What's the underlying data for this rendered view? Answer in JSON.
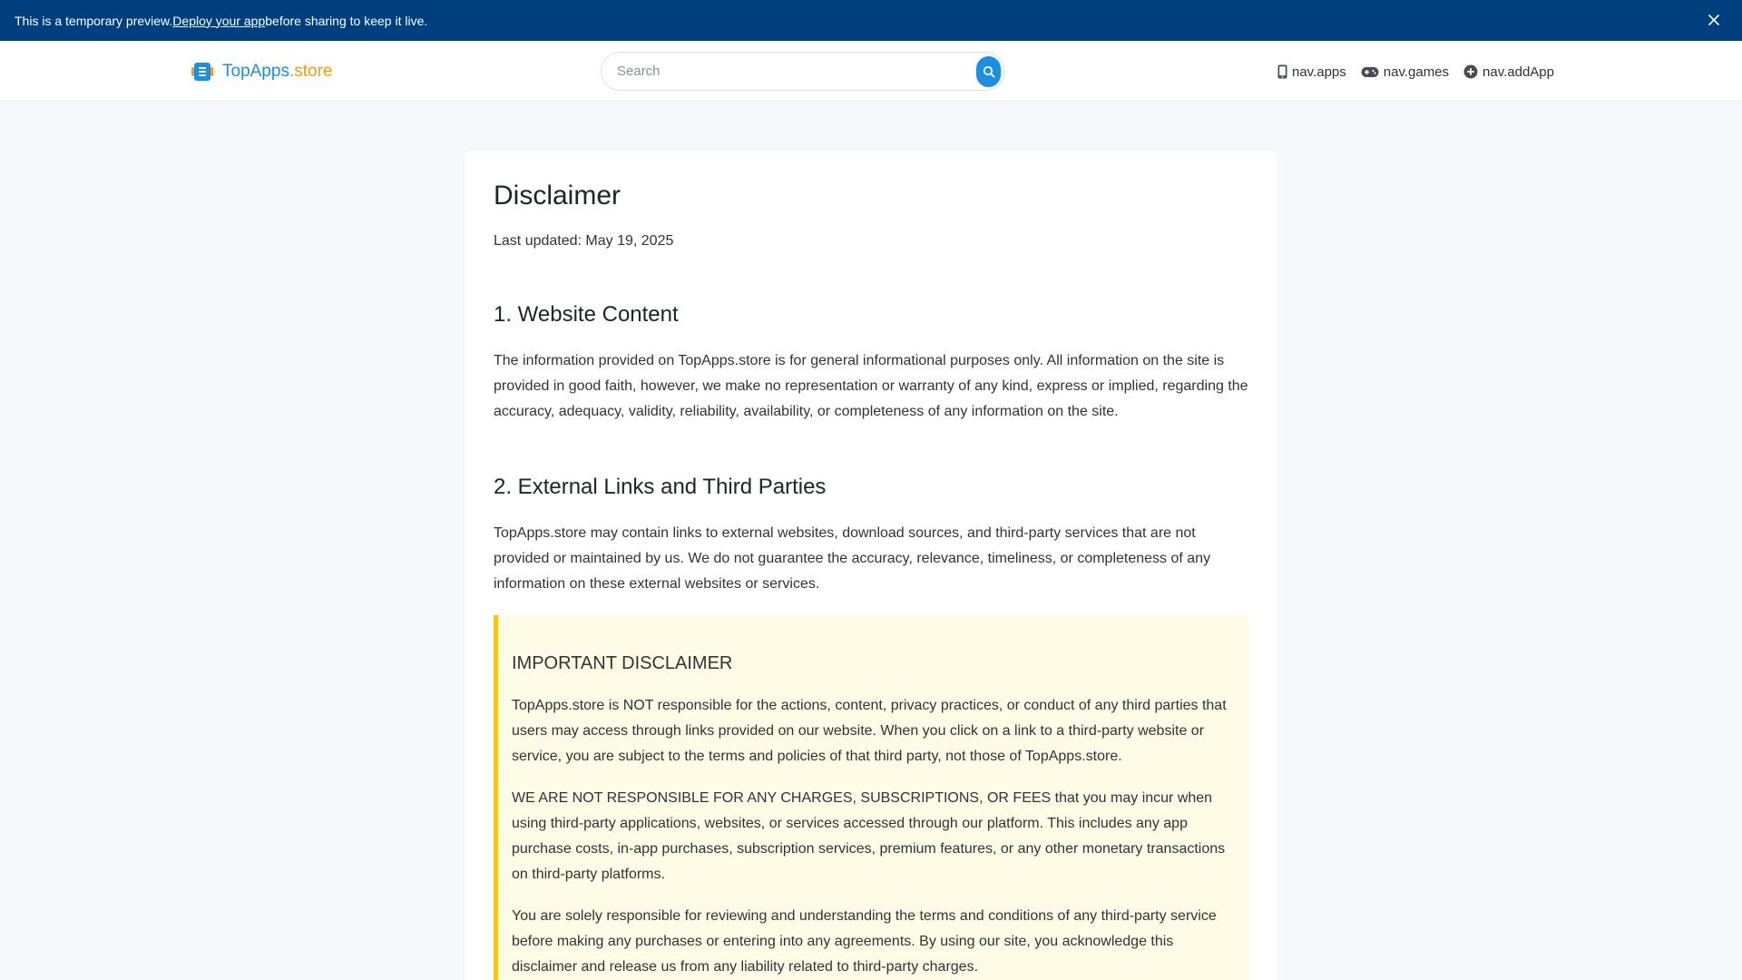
{
  "banner": {
    "text_before": "This is a temporary preview. ",
    "link": "Deploy your app",
    "text_after": " before sharing to keep it live."
  },
  "header": {
    "logo_main": "TopApps",
    "logo_ext": ".store",
    "search_placeholder": "Search",
    "nav": [
      {
        "label": "nav.apps",
        "icon": "phone-icon"
      },
      {
        "label": "nav.games",
        "icon": "gamepad-icon"
      },
      {
        "label": "nav.addApp",
        "icon": "plus-circle-icon"
      }
    ]
  },
  "page": {
    "title": "Disclaimer",
    "updated": "Last updated: May 19, 2025",
    "sections": [
      {
        "heading": "1. Website Content",
        "text": "The information provided on TopApps.store is for general informational purposes only. All information on the site is provided in good faith, however, we make no representation or warranty of any kind, express or implied, regarding the accuracy, adequacy, validity, reliability, availability, or completeness of any information on the site."
      },
      {
        "heading": "2. External Links and Third Parties",
        "text": "TopApps.store may contain links to external websites, download sources, and third-party services that are not provided or maintained by us. We do not guarantee the accuracy, relevance, timeliness, or completeness of any information on these external websites or services."
      }
    ],
    "important": {
      "heading": "IMPORTANT DISCLAIMER",
      "paragraphs": [
        "TopApps.store is NOT responsible for the actions, content, privacy practices, or conduct of any third parties that users may access through links provided on our website. When you click on a link to a third-party website or service, you are subject to the terms and policies of that third party, not those of TopApps.store.",
        "WE ARE NOT RESPONSIBLE FOR ANY CHARGES, SUBSCRIPTIONS, OR FEES that you may incur when using third-party applications, websites, or services accessed through our platform. This includes any app purchase costs, in-app purchases, subscription services, premium features, or any other monetary transactions on third-party platforms.",
        "You are solely responsible for reviewing and understanding the terms and conditions of any third-party service before making any purchases or entering into any agreements. By using our site, you acknowledge this disclaimer and release us from any liability related to third-party charges."
      ]
    }
  },
  "colors": {
    "banner_bg": "#003f7d",
    "brand_blue": "#1a8fe3",
    "brand_orange": "#f39c12",
    "notice_bg": "#fefbe7",
    "notice_border": "#f5c518"
  }
}
